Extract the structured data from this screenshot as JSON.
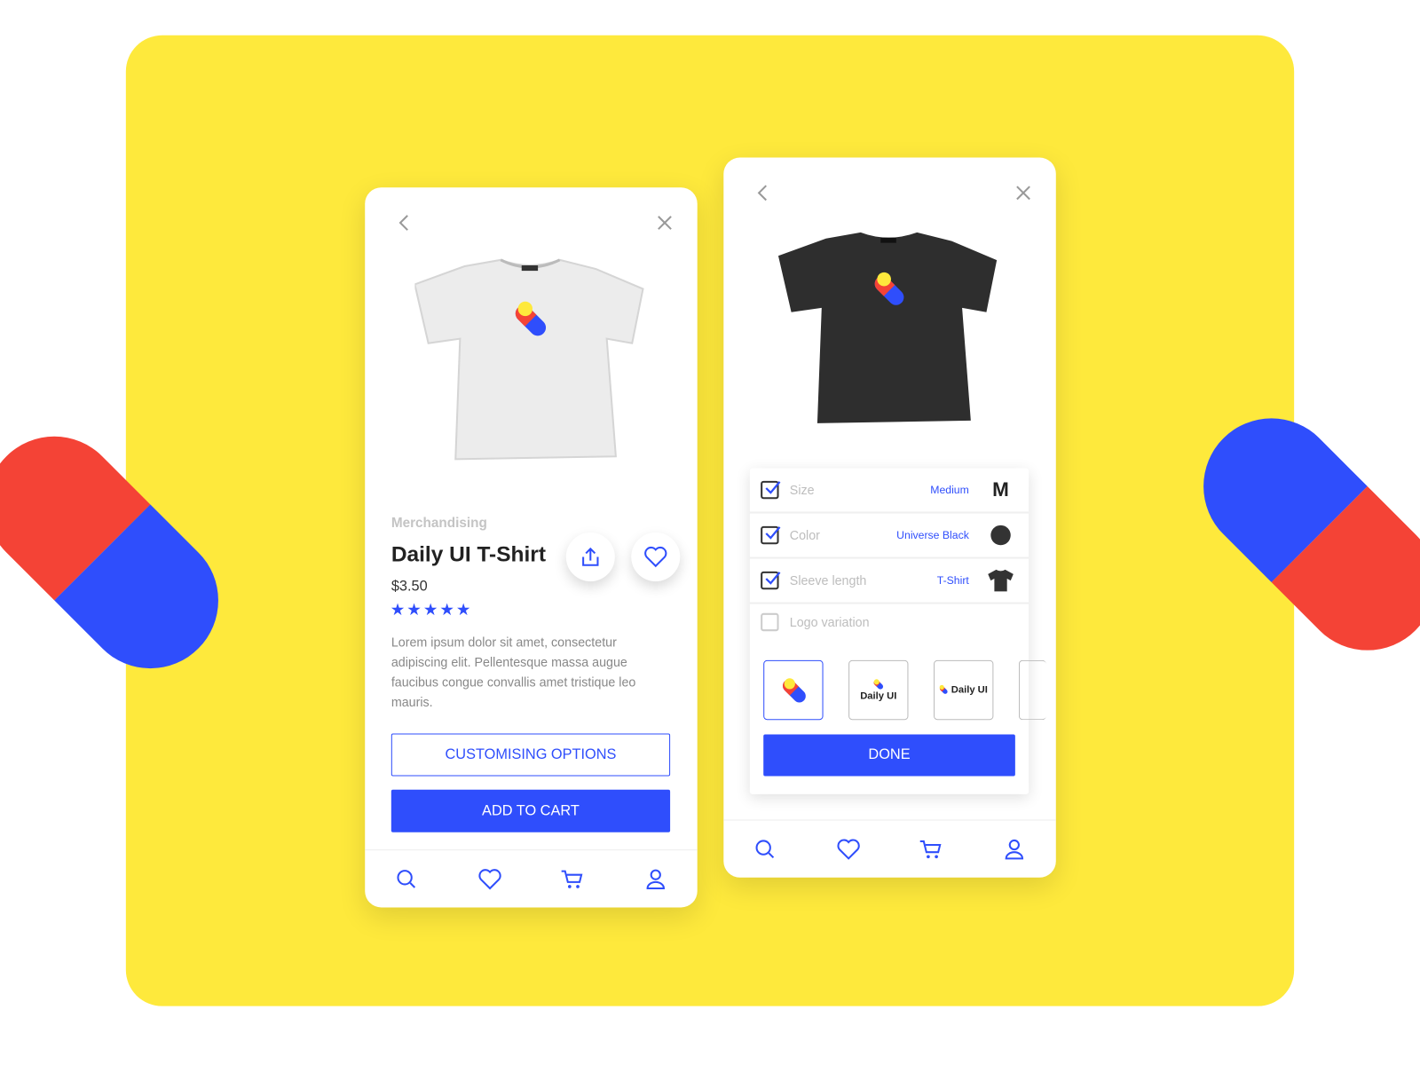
{
  "colors": {
    "accent": "#2f4efc",
    "background": "#fee93c",
    "red": "#f44336",
    "yellow": "#fee93c",
    "dark": "#333333"
  },
  "product": {
    "category": "Merchandising",
    "title": "Daily UI T-Shirt",
    "price": "$3.50",
    "rating": 5,
    "rating_max": 5,
    "description": "Lorem ipsum dolor sit amet, consectetur adipiscing elit. Pellentesque massa augue faucibus congue convallis amet tristique leo mauris.",
    "customise_label": "CUSTOMISING OPTIONS",
    "add_to_cart_label": "ADD TO CART"
  },
  "customise": {
    "options": [
      {
        "label": "Size",
        "value": "Medium",
        "checked": true,
        "icon_text": "M"
      },
      {
        "label": "Color",
        "value": "Universe Black",
        "checked": true
      },
      {
        "label": "Sleeve length",
        "value": "T-Shirt",
        "checked": true
      }
    ],
    "logo_variation_label": "Logo variation",
    "logo_variation_checked": false,
    "logo_tiles": [
      {
        "label": ""
      },
      {
        "label": "Daily UI"
      },
      {
        "label": "Daily UI"
      }
    ],
    "done_label": "DONE"
  },
  "tabbar": [
    "search-icon",
    "heart-icon",
    "cart-icon",
    "user-icon"
  ]
}
